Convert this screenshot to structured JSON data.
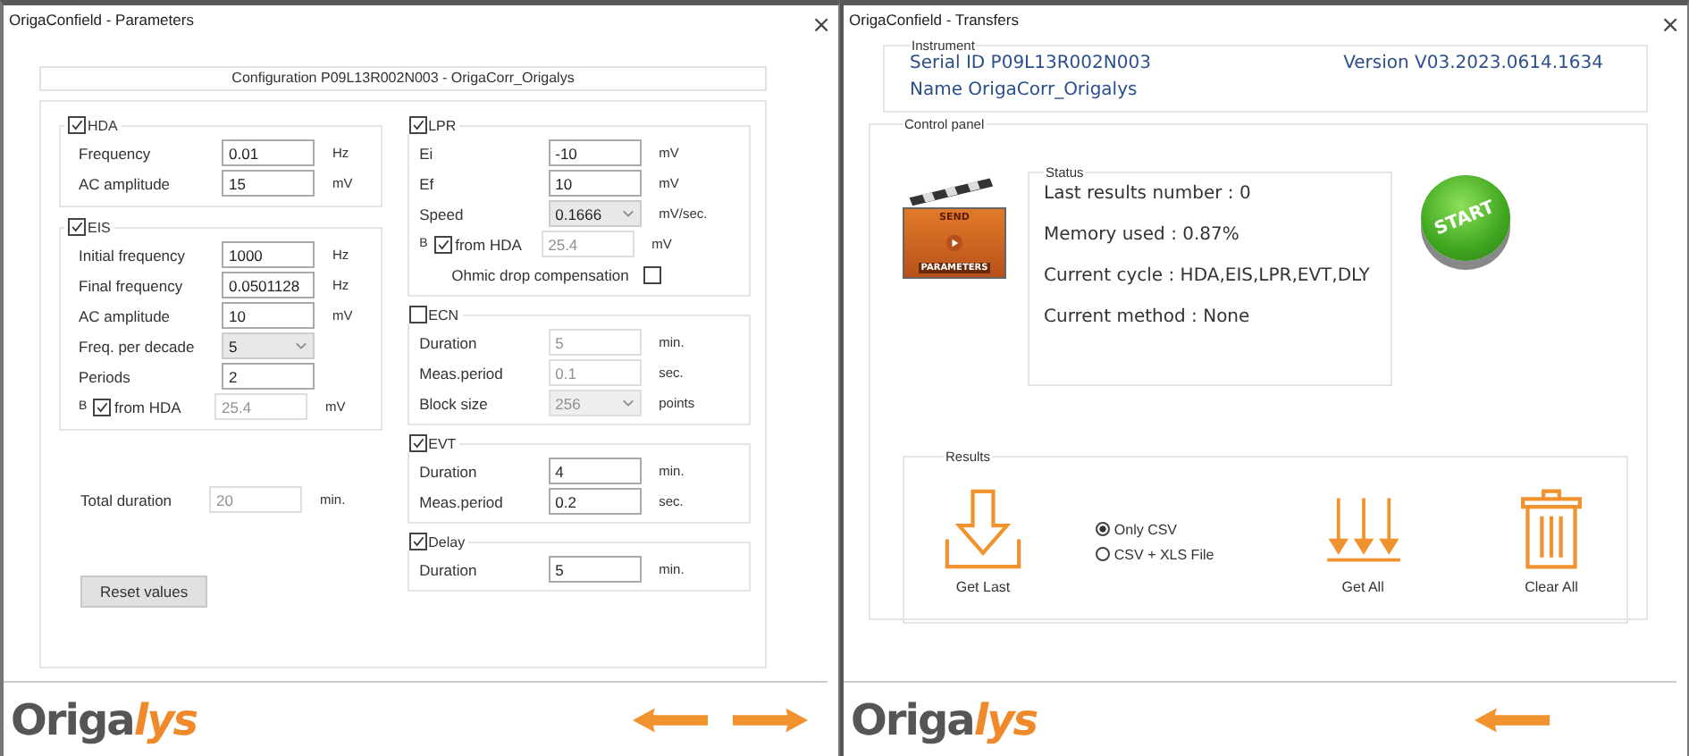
{
  "parameters_window": {
    "title": "OrigaConfield - Parameters",
    "close": "×",
    "configuration": "Configuration P09L13R002N003 - OrigaCorr_Origalys",
    "left_groups": [
      {
        "title": "HDA",
        "checked": true,
        "rows": [
          {
            "kind": "input",
            "label": "Frequency",
            "value": "0.01",
            "unit": "Hz",
            "disabled": false
          },
          {
            "kind": "input",
            "label": "AC amplitude",
            "value": "15",
            "unit": "mV",
            "disabled": false
          }
        ]
      },
      {
        "title": "EIS",
        "checked": true,
        "rows": [
          {
            "kind": "input",
            "label": "Initial frequency",
            "value": "1000",
            "unit": "Hz",
            "disabled": false
          },
          {
            "kind": "input",
            "label": "Final frequency",
            "value": "0.0501128",
            "unit": "Hz",
            "disabled": false
          },
          {
            "kind": "input",
            "label": "AC amplitude",
            "value": "10",
            "unit": "mV",
            "disabled": false
          },
          {
            "kind": "select",
            "label": "Freq. per decade",
            "value": "5",
            "disabled": false
          },
          {
            "kind": "input",
            "label": "Periods",
            "value": "2",
            "disabled": false
          },
          {
            "kind": "from_hda",
            "label": "B",
            "check_label": "from HDA",
            "checked": true,
            "value": "25.4",
            "unit": "mV",
            "disabled": true
          }
        ]
      }
    ],
    "total_duration": {
      "label": "Total duration",
      "value": "20",
      "unit": "min.",
      "disabled": true
    },
    "reset_button": "Reset values",
    "right_groups": [
      {
        "title": "LPR",
        "checked": true,
        "rows": [
          {
            "kind": "input",
            "label": "Ei",
            "value": "-10",
            "unit": "mV",
            "disabled": false
          },
          {
            "kind": "input",
            "label": "Ef",
            "value": "10",
            "unit": "mV",
            "disabled": false
          },
          {
            "kind": "select",
            "label": "Speed",
            "value": "0.1666",
            "unit": "mV/sec.",
            "disabled": false
          },
          {
            "kind": "from_hda",
            "label": "B",
            "check_label": "from HDA",
            "checked": true,
            "value": "25.4",
            "unit": "mV",
            "disabled": true
          },
          {
            "kind": "option",
            "label": "Ohmic drop compensation",
            "checked": false
          }
        ]
      },
      {
        "title": "ECN",
        "checked": false,
        "rows": [
          {
            "kind": "input",
            "label": "Duration",
            "value": "5",
            "unit": "min.",
            "disabled": true
          },
          {
            "kind": "input",
            "label": "Meas.period",
            "value": "0.1",
            "unit": "sec.",
            "disabled": true
          },
          {
            "kind": "select",
            "label": "Block size",
            "value": "256",
            "unit": "points",
            "disabled": true
          }
        ]
      },
      {
        "title": "EVT",
        "checked": true,
        "rows": [
          {
            "kind": "input",
            "label": "Duration",
            "value": "4",
            "unit": "min.",
            "disabled": false
          },
          {
            "kind": "input",
            "label": "Meas.period",
            "value": "0.2",
            "unit": "sec.",
            "disabled": false
          }
        ]
      },
      {
        "title": "Delay",
        "checked": true,
        "rows": [
          {
            "kind": "input",
            "label": "Duration",
            "value": "5",
            "unit": "min.",
            "disabled": false
          }
        ]
      }
    ],
    "logo": {
      "part_1": "Origa",
      "part_2": "lys"
    }
  },
  "transfers_window": {
    "title": "OrigaConfield - Transfers",
    "close": "×",
    "instrument": {
      "legend": "Instrument",
      "serial": "Serial ID P09L13R002N003",
      "version": "Version V03.2023.0614.1634",
      "name": "Name OrigaCorr_Origalys"
    },
    "control_panel": {
      "legend": "Control panel",
      "send_button": {
        "line_1": "SEND",
        "line_2": "PARAMETERS"
      },
      "status": {
        "legend": "Status",
        "lines": [
          "Last results number : 0",
          "Memory used : 0.87%",
          "Current cycle : HDA,EIS,LPR,EVT,DLY",
          "Current method : None"
        ]
      },
      "start_button": "START",
      "results": {
        "legend": "Results",
        "actions": [
          {
            "kind": "get_last",
            "label": "Get Last"
          },
          {
            "kind": "get_all",
            "label": "Get All"
          },
          {
            "kind": "clear_all",
            "label": "Clear All"
          }
        ],
        "formats": [
          {
            "label": "Only CSV",
            "selected": true
          },
          {
            "label": "CSV + XLS File",
            "selected": false
          }
        ]
      }
    },
    "logo": {
      "part_1": "Origa",
      "part_2": "lys"
    }
  }
}
